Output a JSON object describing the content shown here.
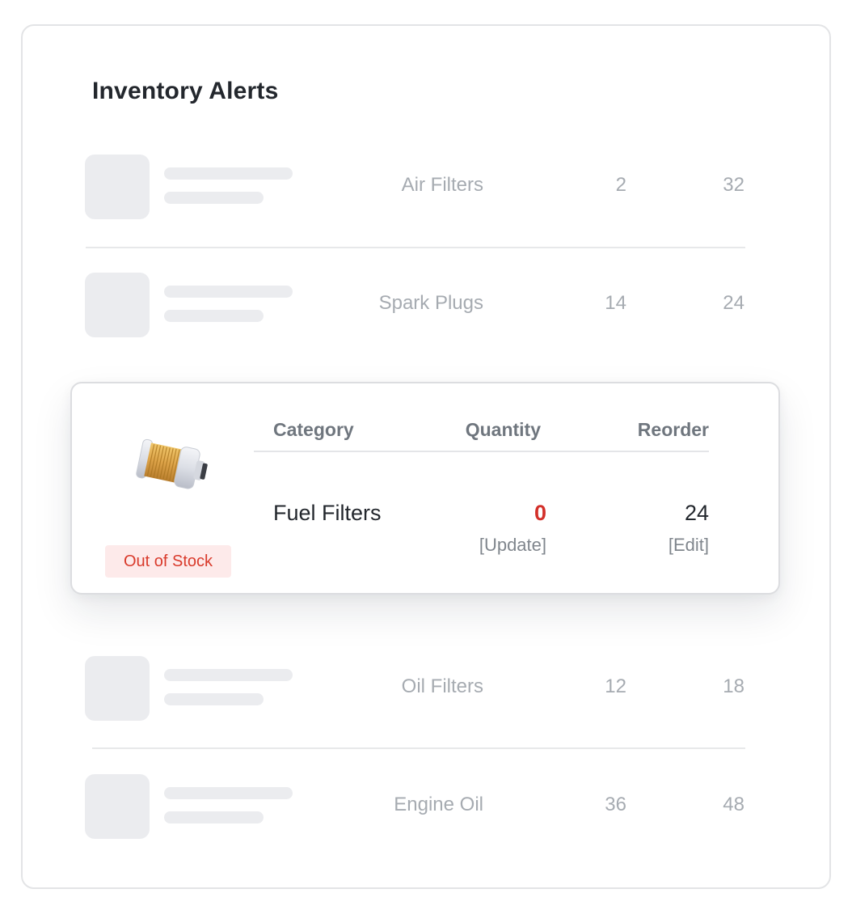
{
  "title": "Inventory Alerts",
  "rows_top": [
    {
      "category": "Air Filters",
      "quantity": "2",
      "reorder": "32"
    },
    {
      "category": "Spark Plugs",
      "quantity": "14",
      "reorder": "24"
    }
  ],
  "rows_bottom": [
    {
      "category": "Oil Filters",
      "quantity": "12",
      "reorder": "18"
    },
    {
      "category": "Engine Oil",
      "quantity": "36",
      "reorder": "48"
    }
  ],
  "focus_card": {
    "headers": {
      "category": "Category",
      "quantity": "Quantity",
      "reorder": "Reorder"
    },
    "item": {
      "category": "Fuel Filters",
      "quantity": "0",
      "reorder": "24"
    },
    "actions": {
      "update": "[Update]",
      "edit": "[Edit]"
    },
    "status_badge": "Out of Stock",
    "image_icon": "fuel-filter-icon"
  },
  "colors": {
    "alert_red": "#d3302a",
    "badge_bg": "#fdeaea",
    "muted_text": "#a6abb1",
    "skeleton": "#ebecef"
  }
}
